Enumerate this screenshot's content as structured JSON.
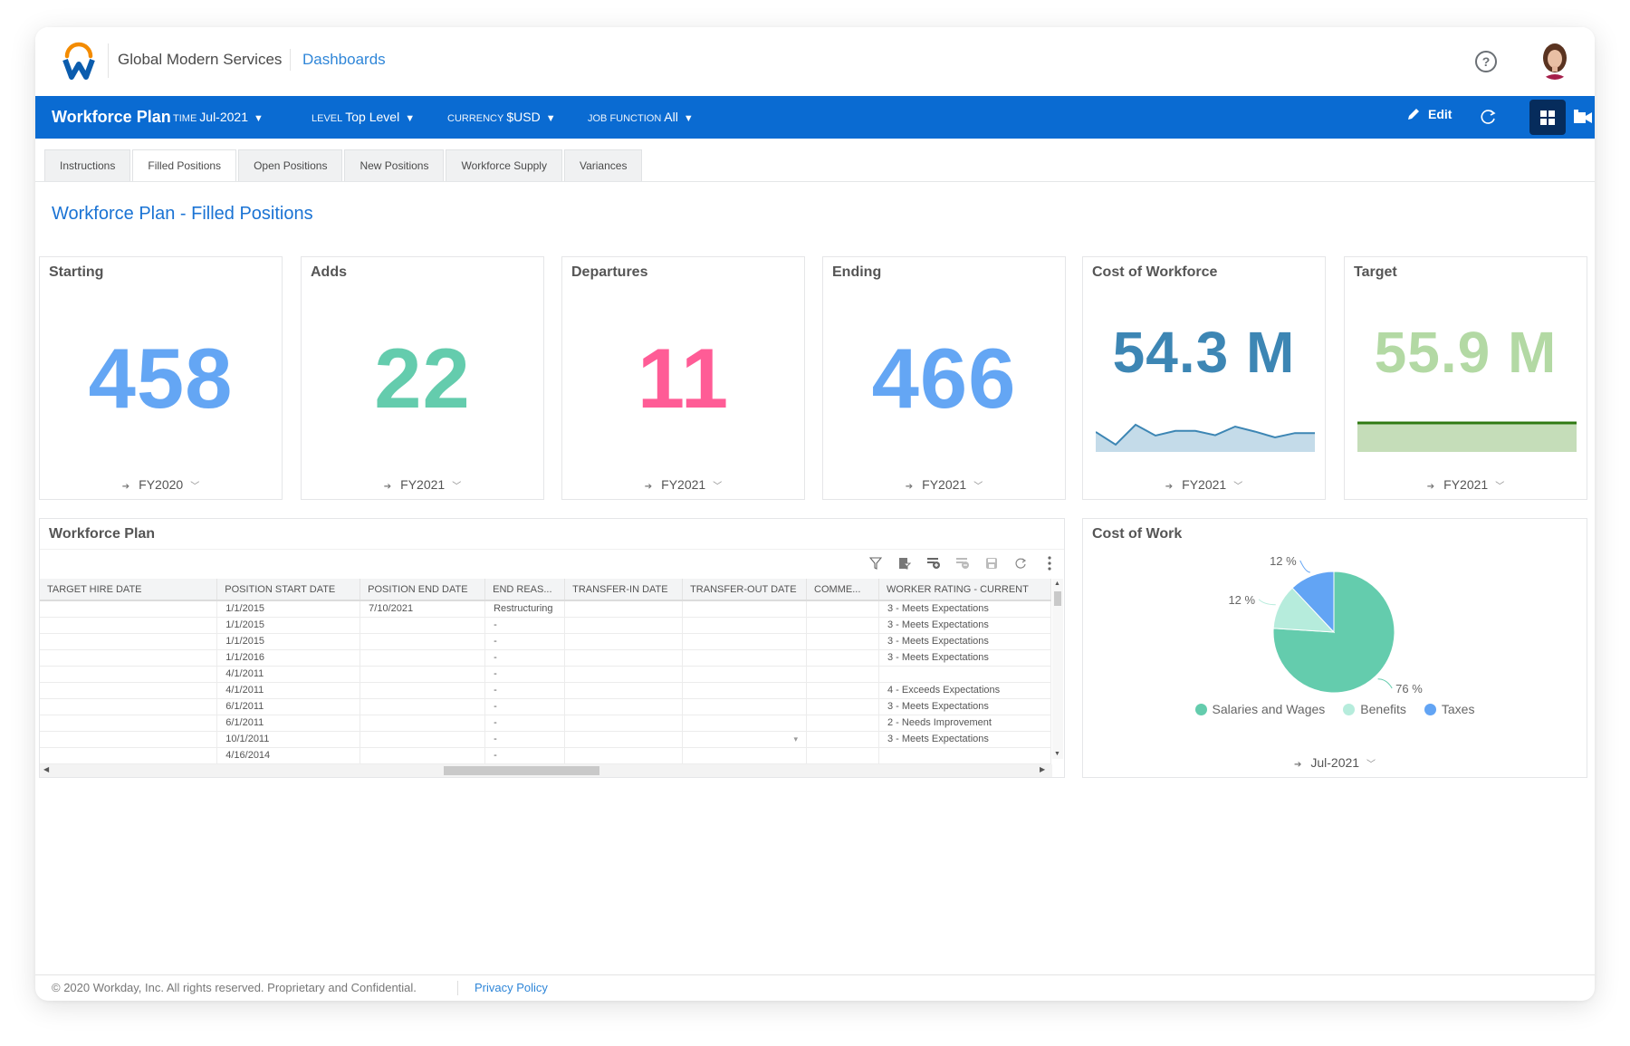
{
  "header": {
    "org_name": "Global Modern Services",
    "nav_link": "Dashboards",
    "logo_colors": {
      "arc": "#f38b00",
      "w": "#0b5cad"
    }
  },
  "appbar": {
    "title": "Workforce Plan",
    "prompts": [
      {
        "label": "Time",
        "value": "Jul-2021"
      },
      {
        "label": "Level",
        "value": "Top Level"
      },
      {
        "label": "Currency",
        "value": "$USD"
      },
      {
        "label": "Job Function",
        "value": "All"
      }
    ],
    "edit_label": "Edit",
    "icons": [
      "pencil-icon",
      "refresh-icon",
      "grid-layout-icon",
      "video-icon"
    ],
    "color": "#0a6bd2"
  },
  "tabs": [
    {
      "label": "Instructions",
      "active": false
    },
    {
      "label": "Filled Positions",
      "active": true
    },
    {
      "label": "Open Positions",
      "active": false
    },
    {
      "label": "New Positions",
      "active": false
    },
    {
      "label": "Workforce Supply",
      "active": false
    },
    {
      "label": "Variances",
      "active": false
    }
  ],
  "page_title": "Workforce Plan - Filled Positions",
  "cards": [
    {
      "title": "Starting",
      "value": "458",
      "period": "FY2020",
      "color": "#64a6f4"
    },
    {
      "title": "Adds",
      "value": "22",
      "period": "FY2021",
      "color": "#64ccad"
    },
    {
      "title": "Departures",
      "value": "11",
      "period": "FY2021",
      "color": "#ff5c96"
    },
    {
      "title": "Ending",
      "value": "466",
      "period": "FY2021",
      "color": "#64a6f4"
    },
    {
      "title": "Cost of Workforce",
      "value": "54.3 M",
      "period": "FY2021",
      "color": "#3d86b4",
      "sparkline": [
        0.55,
        0.2,
        0.75,
        0.45,
        0.58,
        0.58,
        0.46,
        0.7,
        0.56,
        0.4,
        0.52,
        0.52
      ]
    },
    {
      "title": "Target",
      "value": "55.9 M",
      "period": "FY2021",
      "color": "#b3d9a4",
      "sparkline": [
        0.8,
        0.8
      ]
    }
  ],
  "workforce_table": {
    "title": "Workforce Plan",
    "toolbar_icons": [
      "filter-icon",
      "edit-filter-icon",
      "add-row-icon",
      "remove-row-icon",
      "save-icon",
      "refresh-icon",
      "more-vertical-icon"
    ],
    "columns": [
      "TARGET HIRE DATE",
      "POSITION START DATE",
      "POSITION END DATE",
      "END REAS...",
      "TRANSFER-IN DATE",
      "TRANSFER-OUT DATE",
      "COMME...",
      "WORKER RATING -  CURRENT"
    ],
    "rows": [
      [
        "",
        "1/1/2015",
        "7/10/2021",
        "Restructuring",
        "",
        "",
        "",
        "3 - Meets Expectations"
      ],
      [
        "",
        "1/1/2015",
        "",
        "-",
        "",
        "",
        "",
        "3 - Meets Expectations"
      ],
      [
        "",
        "1/1/2015",
        "",
        "-",
        "",
        "",
        "",
        "3 - Meets Expectations"
      ],
      [
        "",
        "1/1/2016",
        "",
        "-",
        "",
        "",
        "",
        "3 - Meets Expectations"
      ],
      [
        "",
        "4/1/2011",
        "",
        "-",
        "",
        "",
        "",
        ""
      ],
      [
        "",
        "4/1/2011",
        "",
        "-",
        "",
        "",
        "",
        "4 - Exceeds Expectations"
      ],
      [
        "",
        "6/1/2011",
        "",
        "-",
        "",
        "",
        "",
        "3 - Meets Expectations"
      ],
      [
        "",
        "6/1/2011",
        "",
        "-",
        "",
        "",
        "",
        "2 - Needs Improvement"
      ],
      [
        "",
        "10/1/2011",
        "",
        "-",
        "",
        "▾",
        "",
        "3 - Meets Expectations"
      ],
      [
        "",
        "4/16/2014",
        "",
        "-",
        "",
        "",
        "",
        ""
      ]
    ]
  },
  "cost_of_work": {
    "title": "Cost of Work",
    "period": "Jul-2021"
  },
  "chart_data": {
    "type": "pie",
    "title": "Cost of Work",
    "categories": [
      "Salaries and Wages",
      "Benefits",
      "Taxes"
    ],
    "values": [
      76,
      12,
      12
    ],
    "labels": [
      "76 %",
      "12 %",
      "12 %"
    ],
    "colors": [
      "#64ccad",
      "#b6ecdc",
      "#62a4f4"
    ],
    "legend": "bottom"
  },
  "footer": {
    "copyright": "© 2020 Workday, Inc. All rights reserved. Proprietary and Confidential.",
    "privacy": "Privacy Policy"
  }
}
